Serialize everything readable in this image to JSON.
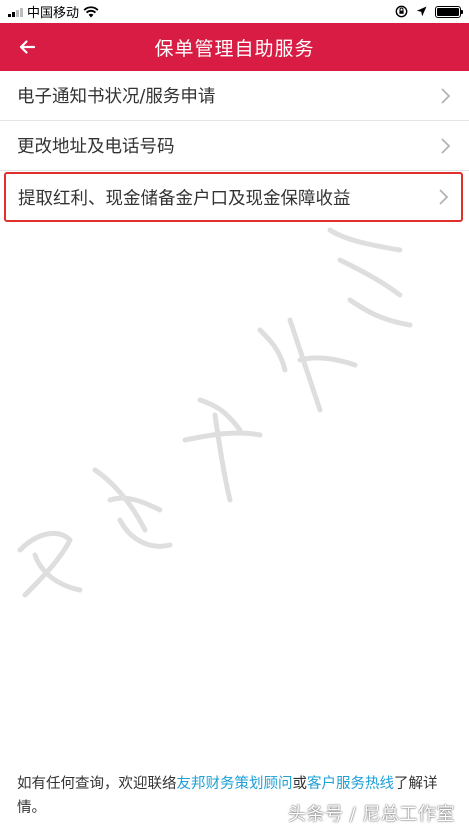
{
  "status_bar": {
    "carrier": "中国移动"
  },
  "nav": {
    "title": "保单管理自助服务"
  },
  "menu": {
    "items": [
      {
        "label": "电子通知书状况/服务申请"
      },
      {
        "label": "更改地址及电话号码"
      },
      {
        "label": "提取红利、现金储备金户口及现金保障收益"
      }
    ]
  },
  "footer": {
    "text_1": "如有任何查询，欢迎联络",
    "link_1": "友邦财务策划顾问",
    "text_2": "或",
    "link_2": "客户服务热线",
    "text_3": "了解详情。"
  },
  "watermark": {
    "toutiao": "头条号 / 尼总工作室"
  },
  "colors": {
    "nav_bg": "#d81c44",
    "highlight_border": "#e0302b",
    "link": "#1e9fd6"
  }
}
